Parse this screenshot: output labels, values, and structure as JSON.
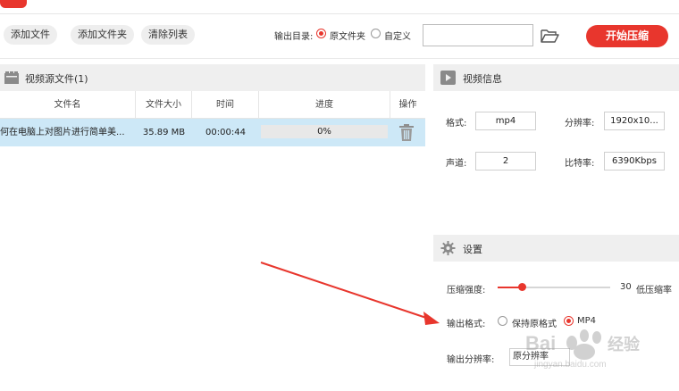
{
  "toolbar": {
    "add_file": "添加文件",
    "add_folder": "添加文件夹",
    "clear_list": "清除列表",
    "output_dir_label": "输出目录:",
    "option_source_folder": "原文件夹",
    "option_custom": "自定义",
    "selected_option": "原文件夹",
    "path_value": "",
    "start": "开始压缩"
  },
  "file_list": {
    "title": "视频源文件(1)",
    "columns": [
      "文件名",
      "文件大小",
      "时间",
      "进度",
      "操作"
    ],
    "rows": [
      {
        "name": "何在电脑上对图片进行简单美...",
        "size": "35.89 MB",
        "time": "00:00:44",
        "progress": "0%",
        "progress_fraction": 0
      }
    ]
  },
  "video_info": {
    "title": "视频信息",
    "format_label": "格式:",
    "format_value": "mp4",
    "resolution_label": "分辨率:",
    "resolution_value": "1920x10...",
    "channels_label": "声道:",
    "channels_value": "2",
    "bitrate_label": "比特率:",
    "bitrate_value": "6390Kbps"
  },
  "settings": {
    "title": "设置",
    "strength_label": "压缩强度:",
    "strength_value": "30",
    "strength_hint": "低压缩率",
    "strength_fraction": 0.3,
    "format_label": "输出格式:",
    "format_keep": "保持原格式",
    "format_mp4": "MP4",
    "format_selected": "MP4",
    "resolution_label": "输出分辨率:",
    "resolution_value": "原分辨率"
  },
  "watermark": {
    "brand": "Baidu经验",
    "url": "jingyan.baidu.com"
  },
  "colors": {
    "accent": "#e8362d",
    "selected_row": "#cde8f7",
    "panel_header": "#efefef"
  }
}
